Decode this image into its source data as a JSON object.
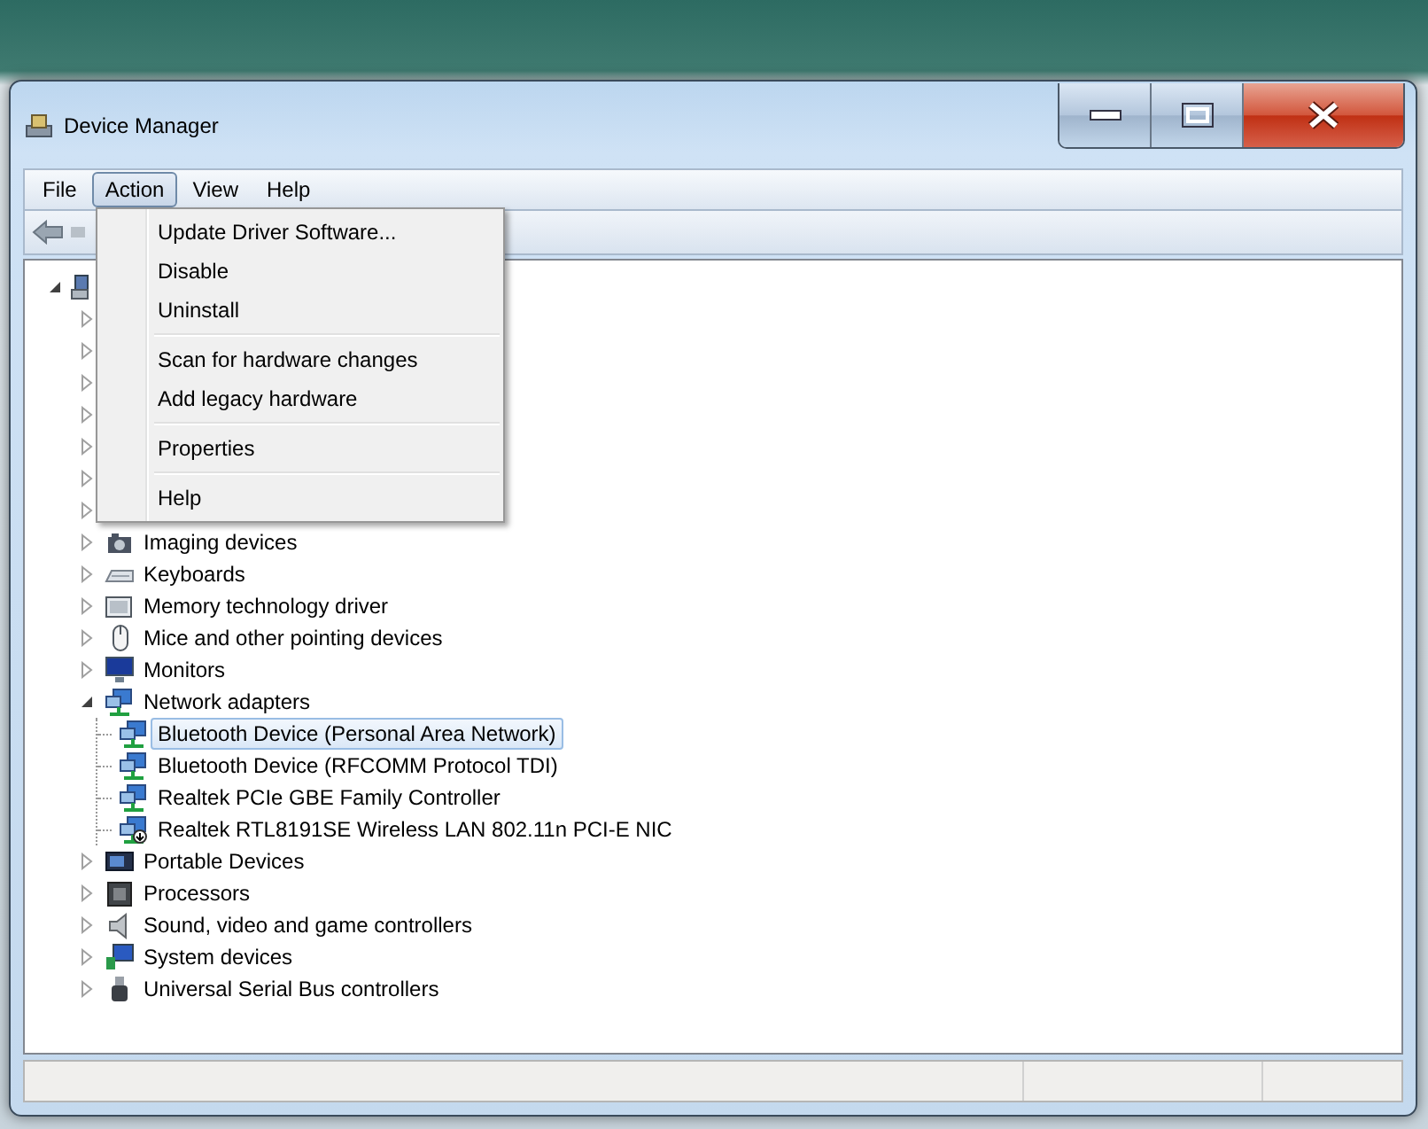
{
  "window": {
    "title": "Device Manager"
  },
  "menu_bar": [
    {
      "label": "File",
      "selected": false
    },
    {
      "label": "Action",
      "selected": true
    },
    {
      "label": "View",
      "selected": false
    },
    {
      "label": "Help",
      "selected": false
    }
  ],
  "action_menu": [
    {
      "kind": "item",
      "label": "Update Driver Software..."
    },
    {
      "kind": "item",
      "label": "Disable"
    },
    {
      "kind": "item",
      "label": "Uninstall"
    },
    {
      "kind": "separator"
    },
    {
      "kind": "item",
      "label": "Scan for hardware changes"
    },
    {
      "kind": "item",
      "label": "Add legacy hardware"
    },
    {
      "kind": "separator"
    },
    {
      "kind": "item",
      "label": "Properties"
    },
    {
      "kind": "separator"
    },
    {
      "kind": "item",
      "label": "Help"
    }
  ],
  "tree": {
    "expanded": true,
    "children": [
      {
        "expanded": false
      },
      {
        "expanded": false
      },
      {
        "expanded": false
      },
      {
        "expanded": false
      },
      {
        "expanded": false
      },
      {
        "expanded": false
      },
      {
        "expanded": false
      },
      {
        "label": "Imaging devices",
        "expanded": false
      },
      {
        "label": "Keyboards",
        "expanded": false
      },
      {
        "label": "Memory technology driver",
        "expanded": false
      },
      {
        "label": "Mice and other pointing devices",
        "expanded": false
      },
      {
        "label": "Monitors",
        "expanded": false
      },
      {
        "label": "Network adapters",
        "expanded": true,
        "children": [
          {
            "label": "Bluetooth Device (Personal Area Network)",
            "selected": true
          },
          {
            "label": "Bluetooth Device (RFCOMM Protocol TDI)",
            "selected": false
          },
          {
            "label": "Realtek PCIe GBE Family Controller",
            "selected": false
          },
          {
            "label": "Realtek RTL8191SE Wireless LAN 802.11n PCI-E NIC",
            "selected": false
          }
        ]
      },
      {
        "label": "Portable Devices",
        "expanded": false
      },
      {
        "label": "Processors",
        "expanded": false
      },
      {
        "label": "Sound, video and game controllers",
        "expanded": false
      },
      {
        "label": "System devices",
        "expanded": false
      },
      {
        "label": "Universal Serial Bus controllers",
        "expanded": false
      }
    ]
  }
}
